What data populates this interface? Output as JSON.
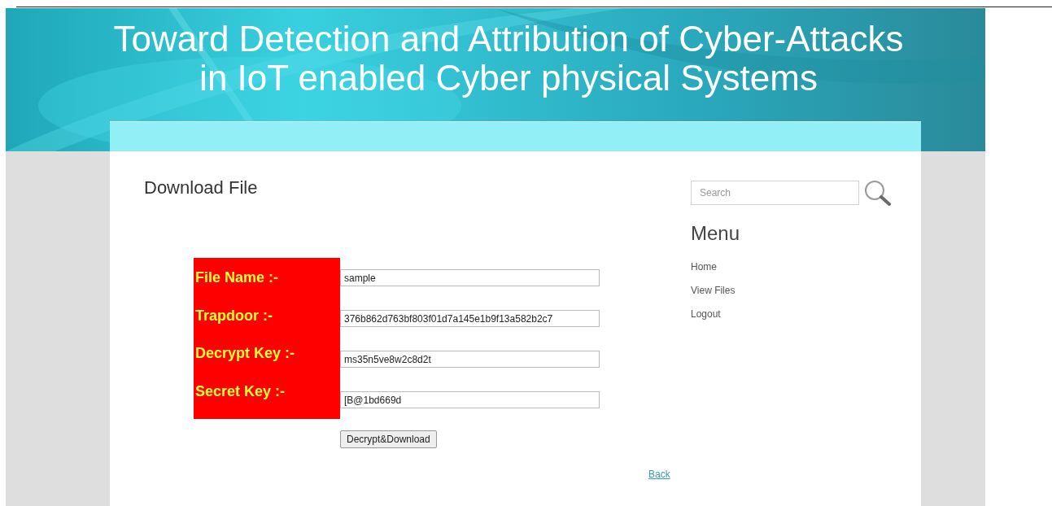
{
  "header": {
    "title": "Toward Detection and Attribution of Cyber-Attacks in IoT enabled Cyber physical Systems"
  },
  "page_title": "Download File",
  "form": {
    "fields": [
      {
        "label": "File Name :-",
        "value": "sample"
      },
      {
        "label": "Trapdoor :-",
        "value": "376b862d763bf803f01d7a145e1b9f13a582b2c7"
      },
      {
        "label": "Decrypt Key :-",
        "value": "ms35n5ve8w2c8d2t"
      },
      {
        "label": "Secret Key :-",
        "value": "[B@1bd669d"
      }
    ],
    "submit": "Decrypt&Download"
  },
  "back_link": "Back",
  "sidebar": {
    "search": {
      "placeholder": "Search"
    },
    "menu_title": "Menu",
    "items": [
      "Home",
      "View Files",
      "Logout"
    ]
  }
}
